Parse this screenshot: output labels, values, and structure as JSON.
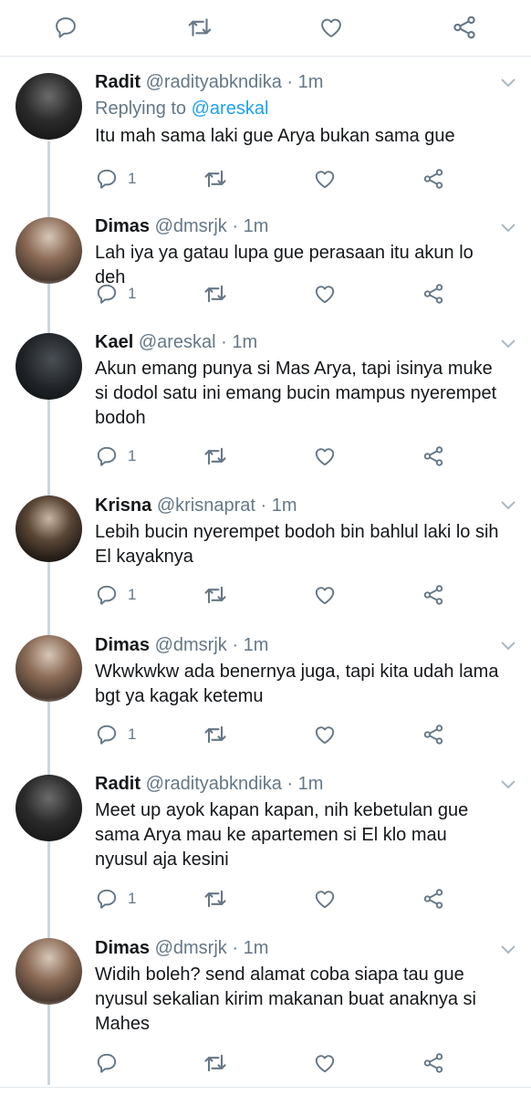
{
  "colors": {
    "accent": "#1da1f2",
    "text": "#14171a",
    "muted": "#657786",
    "divider": "#e1e8ed",
    "thread": "#ccd6dd"
  },
  "top_actions": [
    "reply-icon",
    "retweet-icon",
    "like-icon",
    "share-icon"
  ],
  "tweets": [
    {
      "name": "Radit",
      "handle": "@radityabkndika",
      "dot": "·",
      "time": "1m",
      "replying_prefix": "Replying to ",
      "replying_to": "@areskal",
      "text": "Itu mah sama laki gue Arya bukan sama gue",
      "reply_count": "1"
    },
    {
      "name": "Dimas",
      "handle": "@dmsrjk",
      "dot": "·",
      "time": "1m",
      "text": "Lah iya ya gatau lupa gue perasaan itu akun lo deh",
      "reply_count": "1"
    },
    {
      "name": "Kael",
      "handle": "@areskal",
      "dot": "·",
      "time": "1m",
      "text": "Akun emang punya si Mas Arya, tapi isinya muke si dodol satu ini emang bucin mampus nyerempet bodoh",
      "reply_count": "1"
    },
    {
      "name": "Krisna",
      "handle": "@krisnaprat",
      "dot": "·",
      "time": "1m",
      "text": "Lebih bucin nyerempet bodoh bin bahlul laki lo sih El kayaknya",
      "reply_count": "1"
    },
    {
      "name": "Dimas",
      "handle": "@dmsrjk",
      "dot": "·",
      "time": "1m",
      "text": "Wkwkwkw ada benernya juga, tapi kita udah lama bgt ya kagak ketemu",
      "reply_count": "1"
    },
    {
      "name": "Radit",
      "handle": "@radityabkndika",
      "dot": "·",
      "time": "1m",
      "text": "Meet up ayok kapan kapan, nih kebetulan gue sama Arya mau ke apartemen si El klo mau nyusul aja kesini",
      "reply_count": "1"
    },
    {
      "name": "Dimas",
      "handle": "@dmsrjk",
      "dot": "·",
      "time": "1m",
      "text": "Widih boleh? send alamat coba siapa tau gue nyusul sekalian kirim makanan buat anaknya si Mahes",
      "reply_count": ""
    }
  ]
}
